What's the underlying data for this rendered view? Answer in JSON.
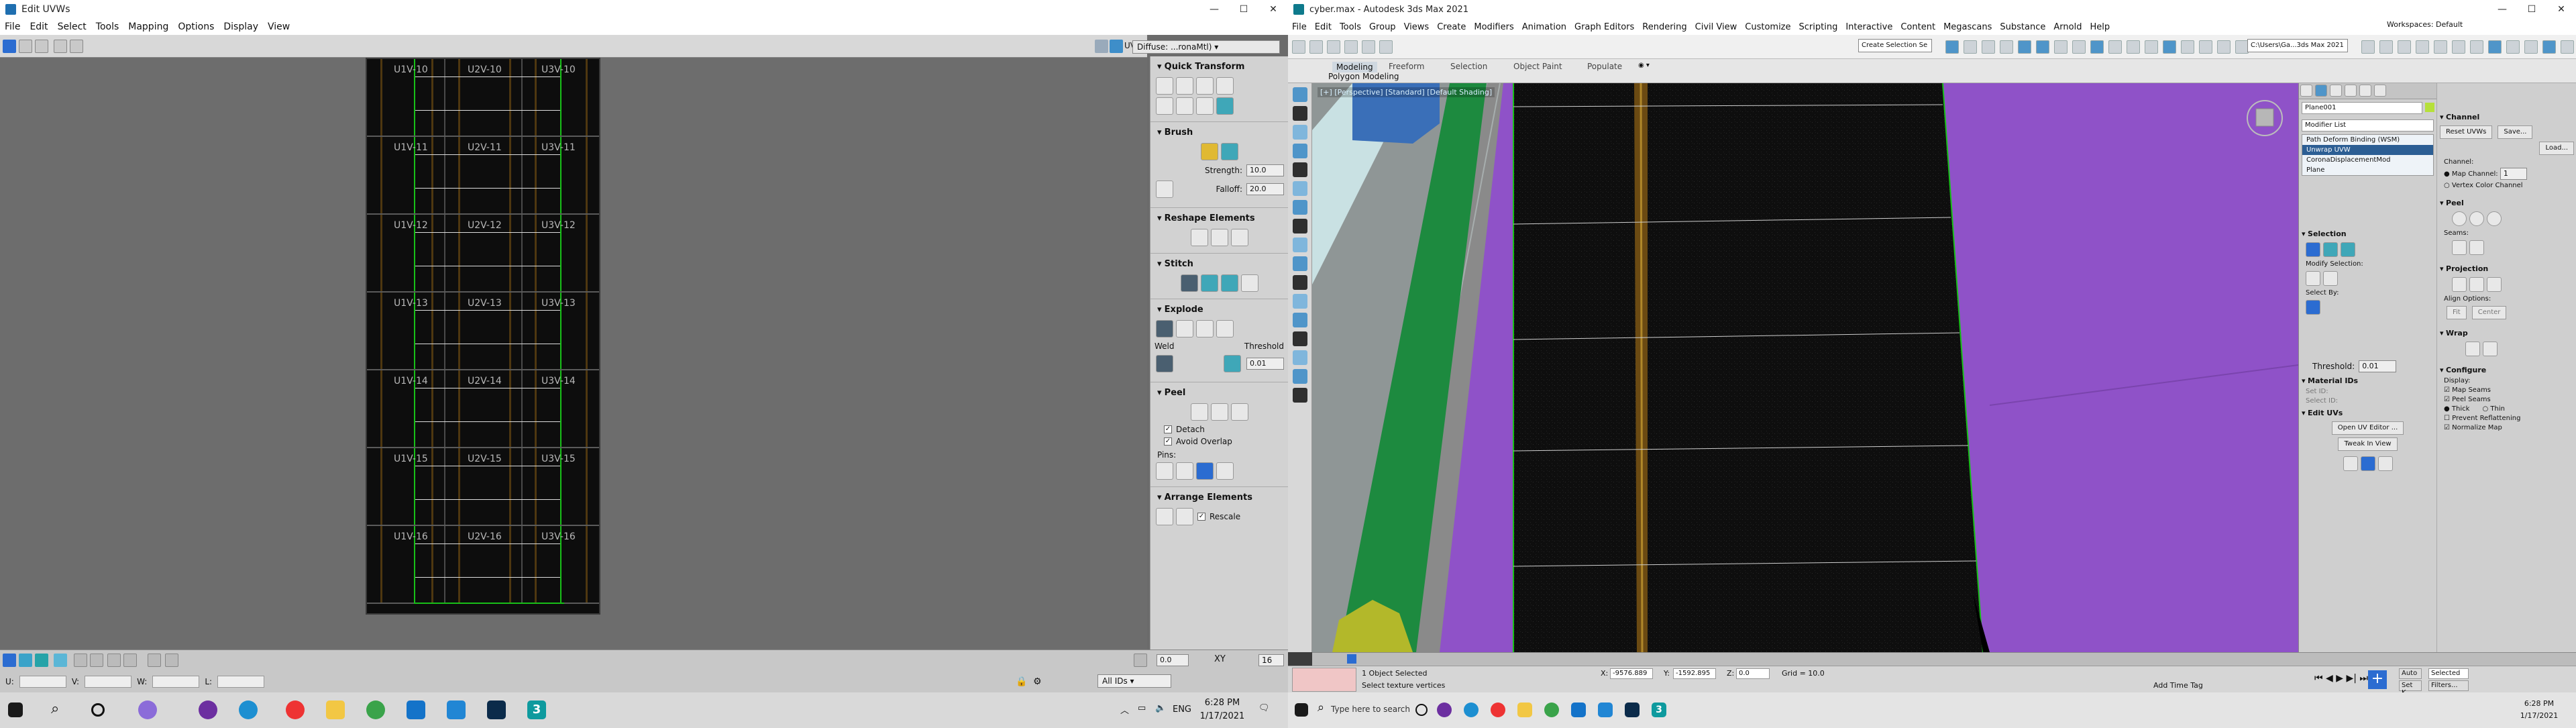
{
  "uv_window": {
    "title": "Edit UVWs",
    "menus": [
      "File",
      "Edit",
      "Select",
      "Tools",
      "Mapping",
      "Options",
      "Display",
      "View"
    ],
    "map_select": "Diffuse: ...ronaMtl)",
    "uv_label": "UV",
    "tiles": [
      {
        "labels": [
          "U1V-10",
          "U2V-10",
          "U3V-10"
        ]
      },
      {
        "labels": [
          "U1V-11",
          "U2V-11",
          "U3V-11"
        ]
      },
      {
        "labels": [
          "U1V-12",
          "U2V-12",
          "U3V-12"
        ]
      },
      {
        "labels": [
          "U1V-13",
          "U2V-13",
          "U3V-13"
        ]
      },
      {
        "labels": [
          "U1V-14",
          "U2V-14",
          "U3V-14"
        ]
      },
      {
        "labels": [
          "U1V-15",
          "U2V-15",
          "U3V-15"
        ]
      },
      {
        "labels": [
          "U1V-16",
          "U2V-16",
          "U3V-16"
        ]
      }
    ],
    "rollouts": {
      "quick_transform": "Quick Transform",
      "brush": "Brush",
      "strength_label": "Strength:",
      "strength_value": "10.0",
      "falloff_label": "Falloff:",
      "falloff_value": "20.0",
      "reshape": "Reshape Elements",
      "stitch": "Stitch",
      "explode": "Explode",
      "weld_label": "Weld",
      "threshold_label": "Threshold",
      "threshold_value": "0.01",
      "peel": "Peel",
      "detach_label": "Detach",
      "avoid_overlap_label": "Avoid Overlap",
      "pins_label": "Pins:",
      "arrange": "Arrange Elements",
      "rescale_label": "Rescale"
    },
    "bottom": {
      "u_label": "U:",
      "v_label": "V:",
      "w_label": "W:",
      "l_label": "L:",
      "zero_value": "0.0",
      "all_ids": "All IDs",
      "xy_label": "XY",
      "zoom_value": "16"
    }
  },
  "max_window": {
    "title": "cyber.max - Autodesk 3ds Max 2021",
    "menus": [
      "File",
      "Edit",
      "Tools",
      "Group",
      "Views",
      "Create",
      "Modifiers",
      "Animation",
      "Graph Editors",
      "Rendering",
      "Civil View",
      "Customize",
      "Scripting",
      "Interactive",
      "Content",
      "Megascans",
      "Substance",
      "Arnold",
      "Help"
    ],
    "workspaces": "Workspaces: Default",
    "path_select": "C:\\Users\\Ga...3ds Max 2021",
    "selection_set": "Create Selection Se",
    "ribbon_tabs": [
      "Modeling",
      "Freeform",
      "Selection",
      "Object Paint",
      "Populate"
    ],
    "ribbon_sub": "Polygon Modeling",
    "viewport_label": "[+] [Perspective] [Standard] [Default Shading]",
    "command_panel": {
      "object_name": "Plane001",
      "modifier_list": "Modifier List",
      "stack": [
        "Path Deform Binding (WSM)",
        "Unwrap UVW",
        "CoronaDisplacementMod",
        "Plane"
      ],
      "channel_title": "Channel",
      "reset_uvws": "Reset UVWs",
      "save": "Save...",
      "load": "Load...",
      "channel_label": "Channel:",
      "map_channel": "Map Channel:",
      "map_channel_value": "1",
      "vertex_color": "Vertex Color Channel",
      "selection_title": "Selection",
      "modify_selection": "Modify Selection:",
      "select_by": "Select By:",
      "threshold_label": "Threshold:",
      "threshold_value": "0.01",
      "material_ids": "Material IDs",
      "set_id": "Set ID:",
      "select_id": "Select ID:",
      "edit_uvs": "Edit UVs",
      "open_uv_editor": "Open UV Editor ...",
      "tweak_in_view": "Tweak In View",
      "peel_title": "Peel",
      "seams_label": "Seams:",
      "projection_title": "Projection",
      "align_options": "Align Options:",
      "fit": "Fit",
      "center": "Center",
      "wrap_title": "Wrap",
      "configure_title": "Configure",
      "display_label": "Display:",
      "map_seams": "Map Seams",
      "peel_seams": "Peel Seams",
      "thick": "Thick",
      "thin": "Thin",
      "prevent_reflattening": "Prevent Reflattening",
      "normalize_map": "Normalize Map"
    },
    "status": {
      "objects_selected": "1 Object Selected",
      "prompt": "Select texture vertices",
      "x_label": "X:",
      "x_value": "-9576.889",
      "y_label": "Y:",
      "y_value": "-1592.895",
      "z_label": "Z:",
      "z_value": "0.0",
      "grid": "Grid = 10.0",
      "add_time_tag": "Add Time Tag",
      "auto": "Auto",
      "selected": "Selected",
      "set_key": "Set K.",
      "filters": "Filters..."
    }
  },
  "taskbar_left": {
    "language": "ENG",
    "time": "6:28 PM",
    "date": "1/17/2021"
  },
  "taskbar_right": {
    "search_placeholder": "Type here to search",
    "time": "6:28 PM",
    "date": "1/17/2021"
  },
  "colors": {
    "uv_green": "#18c018",
    "purple": "#8f52c8",
    "green_wall": "#1d8a3f",
    "max_blue": "#4f95c9"
  }
}
